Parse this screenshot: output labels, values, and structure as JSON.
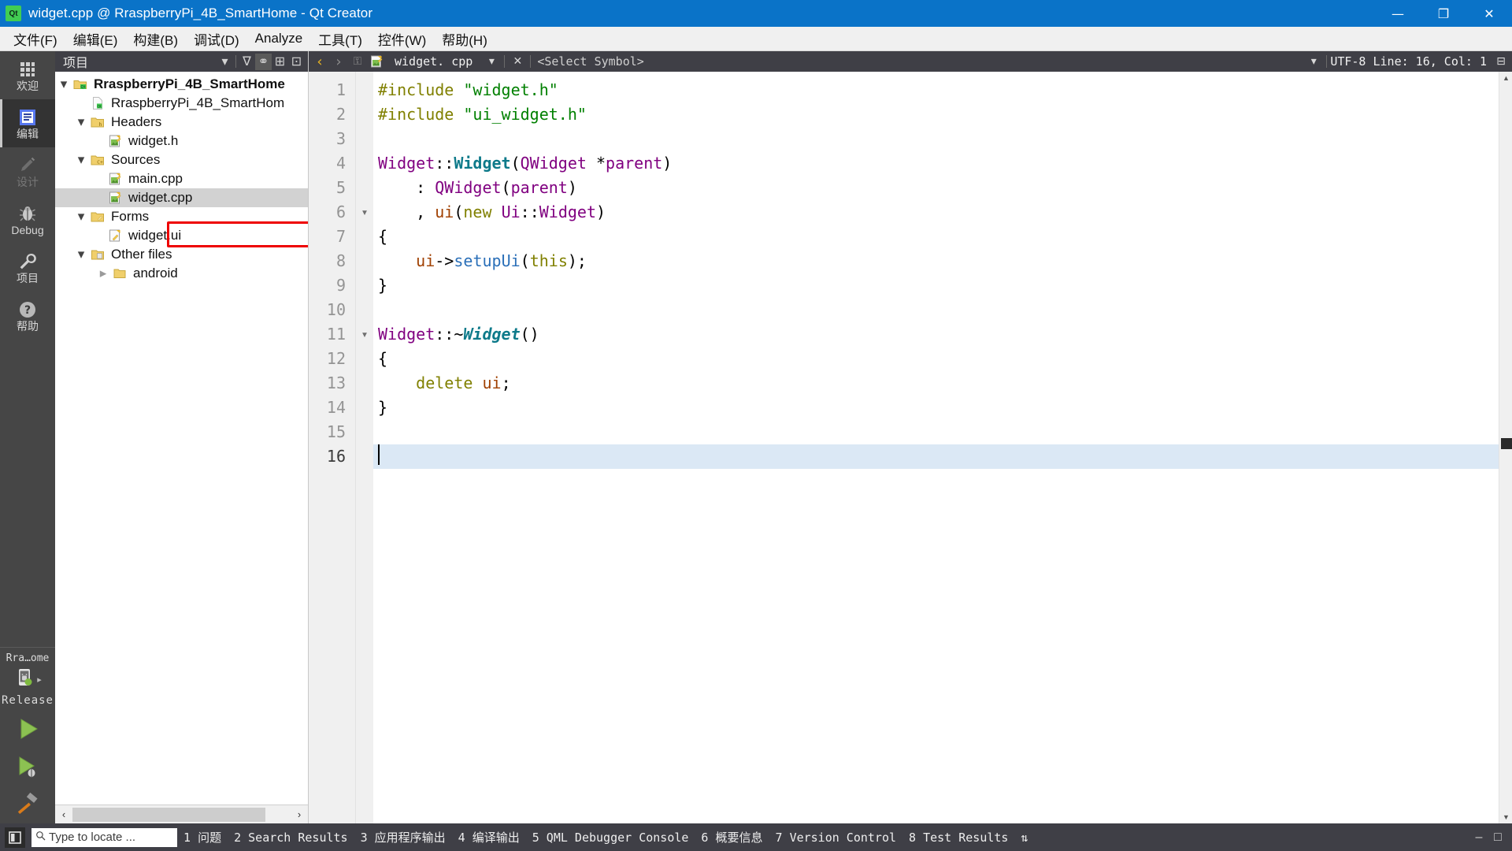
{
  "window": {
    "title": "widget.cpp @ RraspberryPi_4B_SmartHome - Qt Creator",
    "logo_text": "Qt",
    "minimize": "—",
    "maximize": "❐",
    "close": "✕"
  },
  "menubar": {
    "items": [
      {
        "label": "文件(F)"
      },
      {
        "label": "编辑(E)"
      },
      {
        "label": "构建(B)"
      },
      {
        "label": "调试(D)"
      },
      {
        "label": "Analyze"
      },
      {
        "label": "工具(T)"
      },
      {
        "label": "控件(W)"
      },
      {
        "label": "帮助(H)"
      }
    ]
  },
  "modebar": {
    "modes": [
      {
        "label": "欢迎",
        "icon": "grid-icon",
        "state": "normal"
      },
      {
        "label": "编辑",
        "icon": "edit-document-icon",
        "state": "active"
      },
      {
        "label": "设计",
        "icon": "pencil-icon",
        "state": "disabled"
      },
      {
        "label": "Debug",
        "icon": "bug-icon",
        "state": "normal"
      },
      {
        "label": "项目",
        "icon": "wrench-icon",
        "state": "normal"
      },
      {
        "label": "帮助",
        "icon": "question-circle-icon",
        "state": "normal"
      }
    ],
    "kit": {
      "name": "Rra…ome",
      "build_config": "Release",
      "device_icon": "android-device-icon",
      "run_label": "run-button",
      "debug_label": "debug-button",
      "build_label": "build-button"
    }
  },
  "project_panel": {
    "header_title": "项目",
    "header_buttons": [
      {
        "name": "filter-dropdown-icon",
        "glyph": "▾"
      },
      {
        "name": "filter-icon",
        "glyph": "∇"
      },
      {
        "name": "link-with-editor-icon",
        "glyph": "⚭"
      },
      {
        "name": "add-split-icon",
        "glyph": "⊞"
      },
      {
        "name": "close-split-icon",
        "glyph": "⊡"
      }
    ],
    "tree": [
      {
        "label": "RraspberryPi_4B_SmartHome",
        "indent": 0,
        "arrow": "down",
        "icon": "qt-project-icon",
        "bold": true,
        "selected": false
      },
      {
        "label": "RraspberryPi_4B_SmartHom",
        "indent": 1,
        "arrow": "none",
        "icon": "qt-pro-file-icon",
        "bold": false,
        "selected": false
      },
      {
        "label": "Headers",
        "indent": 1,
        "arrow": "down",
        "icon": "headers-folder-icon",
        "bold": false,
        "selected": false
      },
      {
        "label": "widget.h",
        "indent": 2,
        "arrow": "none",
        "icon": "cpp-header-file-icon",
        "bold": false,
        "selected": false
      },
      {
        "label": "Sources",
        "indent": 1,
        "arrow": "down",
        "icon": "sources-folder-icon",
        "bold": false,
        "selected": false
      },
      {
        "label": "main.cpp",
        "indent": 2,
        "arrow": "none",
        "icon": "cpp-source-file-icon",
        "bold": false,
        "selected": false
      },
      {
        "label": "widget.cpp",
        "indent": 2,
        "arrow": "none",
        "icon": "cpp-source-file-icon",
        "bold": false,
        "selected": true
      },
      {
        "label": "Forms",
        "indent": 1,
        "arrow": "down",
        "icon": "forms-folder-icon",
        "bold": false,
        "selected": false
      },
      {
        "label": "widget.ui",
        "indent": 2,
        "arrow": "none",
        "icon": "ui-form-file-icon",
        "bold": false,
        "selected": false
      },
      {
        "label": "Other files",
        "indent": 1,
        "arrow": "down",
        "icon": "other-files-icon",
        "bold": false,
        "selected": false
      },
      {
        "label": "android",
        "indent": 2,
        "arrow": "right",
        "icon": "folder-icon",
        "bold": false,
        "selected": false
      }
    ],
    "highlight": {
      "target_label": "widget.ui",
      "color": "#ee0000"
    },
    "scroll": {
      "left_arrow": "‹",
      "right_arrow": "›"
    }
  },
  "editor": {
    "toolbar": {
      "buttons": [
        {
          "name": "dropdown-icon",
          "glyph": "▾"
        },
        {
          "name": "filter-icon",
          "glyph": "∇"
        },
        {
          "name": "link-icon",
          "glyph": "⚭"
        },
        {
          "name": "split-add-icon",
          "glyph": "⊞"
        },
        {
          "name": "split-remove-icon",
          "glyph": "⊡"
        },
        {
          "name": "back-icon",
          "glyph": "‹"
        },
        {
          "name": "forward-icon",
          "glyph": "›"
        },
        {
          "name": "unlock-icon",
          "glyph": "⚿"
        }
      ],
      "filename": "widget. cpp",
      "file_icon": "cpp-source-file-icon",
      "file_dropdown": "▾",
      "close_file": "✕",
      "symbol_selector": "<Select Symbol>",
      "encoding_status": "UTF-8 Line: 16, Col: 1",
      "split_icon": "⊟"
    },
    "lines": [
      {
        "n": 1,
        "fold": "",
        "tokens": [
          {
            "t": "pre",
            "v": "#include"
          },
          {
            "t": "plain",
            "v": " "
          },
          {
            "t": "str",
            "v": "\"widget.h\""
          }
        ]
      },
      {
        "n": 2,
        "fold": "",
        "tokens": [
          {
            "t": "pre",
            "v": "#include"
          },
          {
            "t": "plain",
            "v": " "
          },
          {
            "t": "str",
            "v": "\"ui_widget.h\""
          }
        ]
      },
      {
        "n": 3,
        "fold": "",
        "tokens": []
      },
      {
        "n": 4,
        "fold": "",
        "tokens": [
          {
            "t": "type",
            "v": "Widget"
          },
          {
            "t": "punct",
            "v": "::"
          },
          {
            "t": "fn",
            "v": "Widget"
          },
          {
            "t": "punct",
            "v": "("
          },
          {
            "t": "type",
            "v": "QWidget"
          },
          {
            "t": "plain",
            "v": " "
          },
          {
            "t": "punct",
            "v": "*"
          },
          {
            "t": "type",
            "v": "parent"
          },
          {
            "t": "punct",
            "v": ")"
          }
        ]
      },
      {
        "n": 5,
        "fold": "",
        "tokens": [
          {
            "t": "punct",
            "v": "    : "
          },
          {
            "t": "type",
            "v": "QWidget"
          },
          {
            "t": "punct",
            "v": "("
          },
          {
            "t": "type",
            "v": "parent"
          },
          {
            "t": "punct",
            "v": ")"
          }
        ]
      },
      {
        "n": 6,
        "fold": "▾",
        "tokens": [
          {
            "t": "punct",
            "v": "    , "
          },
          {
            "t": "var",
            "v": "ui"
          },
          {
            "t": "punct",
            "v": "("
          },
          {
            "t": "kw",
            "v": "new"
          },
          {
            "t": "plain",
            "v": " "
          },
          {
            "t": "type",
            "v": "Ui"
          },
          {
            "t": "punct",
            "v": "::"
          },
          {
            "t": "type",
            "v": "Widget"
          },
          {
            "t": "punct",
            "v": ")"
          }
        ]
      },
      {
        "n": 7,
        "fold": "",
        "tokens": [
          {
            "t": "punct",
            "v": "{"
          }
        ]
      },
      {
        "n": 8,
        "fold": "",
        "tokens": [
          {
            "t": "plain",
            "v": "    "
          },
          {
            "t": "var",
            "v": "ui"
          },
          {
            "t": "punct",
            "v": "->"
          },
          {
            "t": "mem",
            "v": "setupUi"
          },
          {
            "t": "punct",
            "v": "("
          },
          {
            "t": "this",
            "v": "this"
          },
          {
            "t": "punct",
            "v": ");"
          }
        ]
      },
      {
        "n": 9,
        "fold": "",
        "tokens": [
          {
            "t": "punct",
            "v": "}"
          }
        ]
      },
      {
        "n": 10,
        "fold": "",
        "tokens": []
      },
      {
        "n": 11,
        "fold": "▾",
        "tokens": [
          {
            "t": "type",
            "v": "Widget"
          },
          {
            "t": "punct",
            "v": "::~"
          },
          {
            "t": "fni",
            "v": "Widget"
          },
          {
            "t": "punct",
            "v": "()"
          }
        ]
      },
      {
        "n": 12,
        "fold": "",
        "tokens": [
          {
            "t": "punct",
            "v": "{"
          }
        ]
      },
      {
        "n": 13,
        "fold": "",
        "tokens": [
          {
            "t": "plain",
            "v": "    "
          },
          {
            "t": "kw",
            "v": "delete"
          },
          {
            "t": "plain",
            "v": " "
          },
          {
            "t": "var",
            "v": "ui"
          },
          {
            "t": "punct",
            "v": ";"
          }
        ]
      },
      {
        "n": 14,
        "fold": "",
        "tokens": [
          {
            "t": "punct",
            "v": "}"
          }
        ]
      },
      {
        "n": 15,
        "fold": "",
        "tokens": []
      },
      {
        "n": 16,
        "fold": "",
        "tokens": [],
        "current": true
      }
    ]
  },
  "statusbar": {
    "sidebar_toggle": "sidebar-toggle-icon",
    "locator_placeholder": "Type to locate ...",
    "locator_icon": "search-icon",
    "output_panes": [
      {
        "num": "1",
        "label": "问题"
      },
      {
        "num": "2",
        "label": "Search Results"
      },
      {
        "num": "3",
        "label": "应用程序输出"
      },
      {
        "num": "4",
        "label": "编译输出"
      },
      {
        "num": "5",
        "label": "QML Debugger Console"
      },
      {
        "num": "6",
        "label": "概要信息"
      },
      {
        "num": "7",
        "label": "Version Control"
      },
      {
        "num": "8",
        "label": "Test Results"
      }
    ],
    "pane_resize": "⇅",
    "right_icons": [
      {
        "name": "minimize-output-icon",
        "glyph": "–"
      },
      {
        "name": "maximize-output-icon",
        "glyph": "□"
      }
    ]
  },
  "colors": {
    "titlebar": "#0a73c8",
    "accent_green": "#41cd52",
    "panel_dark": "#3f3f46",
    "mode_bar": "#464646",
    "selection": "#d2d2d2",
    "current_line": "#dbe8f5",
    "annotation_red": "#ee0000"
  }
}
